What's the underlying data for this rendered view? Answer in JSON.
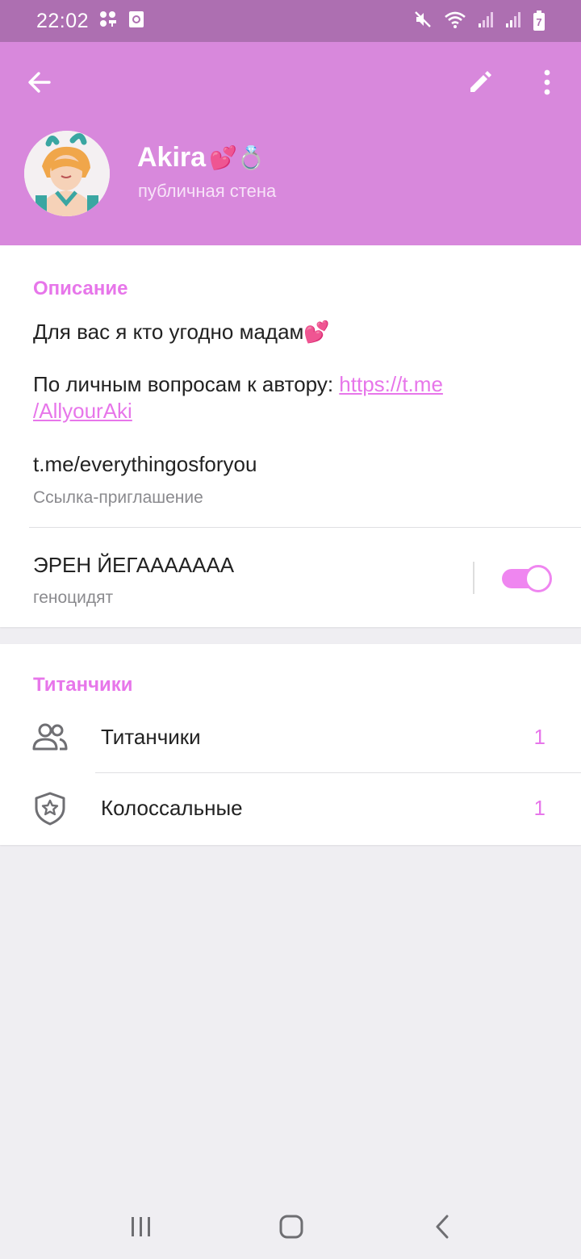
{
  "status_bar": {
    "time": "22:02",
    "left_icons": [
      "notification-dots-icon",
      "screenshot-icon"
    ],
    "right_icons": [
      "mute-icon",
      "wifi-icon",
      "signal-icon",
      "signal-icon",
      "battery-charging-icon"
    ],
    "battery_level": "7"
  },
  "header": {
    "back_icon": "arrow-left-icon",
    "edit_icon": "pencil-icon",
    "menu_icon": "more-vertical-icon",
    "name": "Akira",
    "name_emoji": "💕💍",
    "subtitle": "публичная стена"
  },
  "info": {
    "section_title": "Описание",
    "description_line1": "Для вас я кто угодно мадам💕",
    "description_line2_prefix": "По личным вопросам к автору: ",
    "description_link_part1": "https://t.me",
    "description_link_part2": "/AllyourAki",
    "invite_link": "t.me/everythingosforyou",
    "invite_link_label": "Ссылка-приглашение",
    "toggle_title": "ЭРЕН ЙЕГААААААА",
    "toggle_subtitle": "геноцидят",
    "toggle_on": true
  },
  "members": {
    "section_title": "Титанчики",
    "rows": [
      {
        "icon": "users-icon",
        "label": "Титанчики",
        "count": "1"
      },
      {
        "icon": "shield-star-icon",
        "label": "Колоссальные",
        "count": "1"
      }
    ]
  },
  "nav_bar": {
    "icons": [
      "recent-apps-icon",
      "home-icon",
      "back-chevron-icon"
    ]
  },
  "colors": {
    "status_bar": "#ad6fb1",
    "header": "#d888dc",
    "accent": "#e776ea",
    "background": "#efeef2"
  }
}
